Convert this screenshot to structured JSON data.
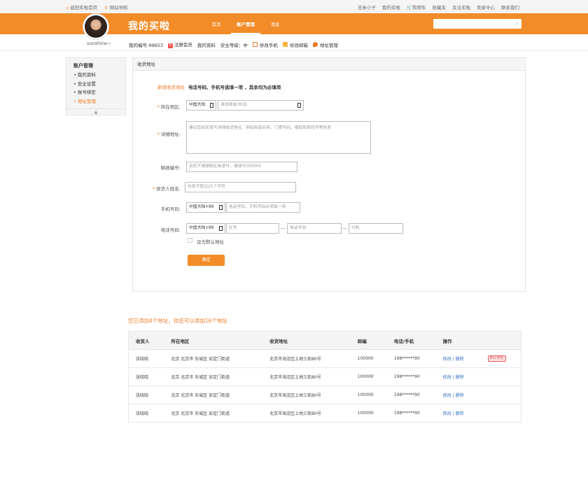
{
  "topbar": {
    "home_link": "返回买啦首页",
    "sitemap_link": "网站导航",
    "user_link": "吉米小子",
    "my_buy": "我的买啦",
    "cart": "购物车",
    "favorites": "收藏夹",
    "follow": "关注买啦",
    "seller": "卖家中心",
    "contact": "联系我们"
  },
  "header": {
    "brand": "我的买啦",
    "nav": [
      "首页",
      "账户管理",
      "消息"
    ],
    "active_nav": "账户管理",
    "search_placeholder": ""
  },
  "profile": {
    "username": "sunshine~"
  },
  "subnav": {
    "user_no": "我的编号:99653",
    "register": "注册会员",
    "profile": "我的资料",
    "security": "安全等级：中",
    "edit_phone": "修改手机",
    "edit_email": "修改邮箱",
    "address": "地址管理"
  },
  "sidebar": {
    "title": "账户管理",
    "items": [
      {
        "label": "• 我的资料",
        "active": false
      },
      {
        "label": "• 安全设置",
        "active": false
      },
      {
        "label": "• 账号绑定",
        "active": false
      },
      {
        "label": "• 地址管理",
        "active": true
      }
    ],
    "fold": "▲"
  },
  "form": {
    "panel_title": "收货地址",
    "tip_orange": "新增收货地址",
    "tip_bold": "电话号码、手机号选填一项 ，其余均为必填项",
    "region_label": "所在地区:",
    "region_country": "中国大陆",
    "region_placeholder": "请选择省/市/区",
    "detail_label": "详细地址:",
    "detail_placeholder": "建议您如实填写详细收货地址，例如街道名称，门牌号码，楼层和房间号等信息",
    "zip_label": "邮政编号:",
    "zip_placeholder": "如您不清楚邮区邮递号，请填写000000",
    "name_label": "收货人姓名:",
    "name_placeholder": "长度不超过25个字符",
    "mobile_label": "手机号码:",
    "mobile_country": "中国大陆+86",
    "mobile_placeholder": "电话号码、手机号码必须填一项",
    "phone_label": "电话号码:",
    "phone_country": "中国大陆+86",
    "area_placeholder": "区号",
    "phone_placeholder": "电话号码",
    "ext_placeholder": "分机",
    "dash": "—",
    "default_label": "设为默认地址",
    "submit": "确定",
    "required_mark": "*"
  },
  "address_list": {
    "count_text": "您已添加4个地址，你还可以添加16个地址",
    "headers": [
      "收货人",
      "所在地区",
      "收货地址",
      "邮编",
      "电话/手机",
      "操作"
    ],
    "rows": [
      {
        "name": "张晓晓",
        "region": "北京 北京市 东城区 安定门街道",
        "address": "北京市海淀区上地三街80号",
        "zip": "100000",
        "phone": "198******90",
        "edit": "修改",
        "sep": "|",
        "del": "删除",
        "default_badge": "默认地址"
      },
      {
        "name": "张晓晓",
        "region": "北京 北京市 东城区 安定门街道",
        "address": "北京市海淀区上地三街80号",
        "zip": "100000",
        "phone": "198******90",
        "edit": "修改",
        "sep": "|",
        "del": "删除",
        "default_badge": ""
      },
      {
        "name": "张晓晓",
        "region": "北京 北京市 东城区 安定门街道",
        "address": "北京市海淀区上地三街80号",
        "zip": "100000",
        "phone": "198******90",
        "edit": "修改",
        "sep": "|",
        "del": "删除",
        "default_badge": ""
      },
      {
        "name": "张晓晓",
        "region": "北京 北京市 东城区 安定门街道",
        "address": "北京市海淀区上地三街80号",
        "zip": "100000",
        "phone": "198******90",
        "edit": "修改",
        "sep": "|",
        "del": "删除",
        "default_badge": ""
      }
    ]
  },
  "colors": {
    "brand_orange": "#f28c28",
    "link_blue": "#3a73c4",
    "badge_red": "#e05555"
  }
}
